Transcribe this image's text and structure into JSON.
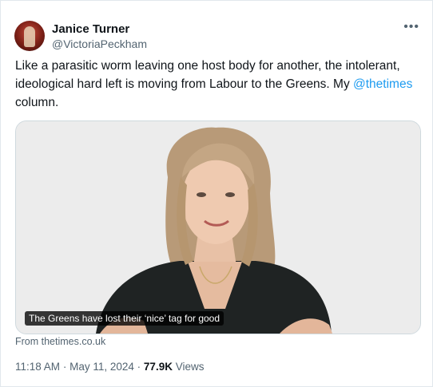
{
  "author": {
    "name": "Janice Turner",
    "handle": "@VictoriaPeckham"
  },
  "menu_icon": "more-options-icon",
  "tweet": {
    "text_before": "Like a parasitic worm leaving one host body for another, the intolerant, ideological hard left is moving from Labour to the Greens. My ",
    "mention": "@thetimes",
    "text_after": " column."
  },
  "card": {
    "caption": "The Greens have lost their ‘nice’ tag for good",
    "source": "From thetimes.co.uk"
  },
  "meta": {
    "time": "11:18 AM",
    "separator": "·",
    "date": "May 11, 2024",
    "views_count": "77.9K",
    "views_label": "Views"
  },
  "colors": {
    "link": "#1d9bf0",
    "secondary_text": "#536471",
    "primary_text": "#0f1419"
  }
}
